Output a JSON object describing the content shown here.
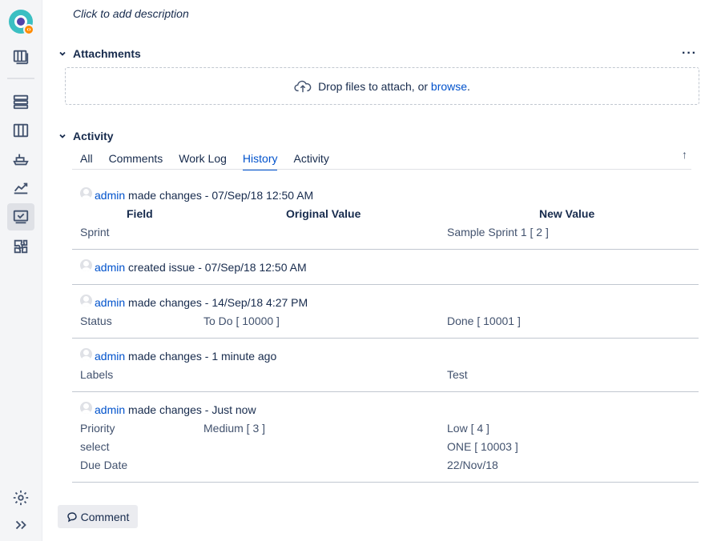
{
  "description": {
    "placeholder": "Click to add description"
  },
  "attachments": {
    "title": "Attachments",
    "more": "···",
    "drop_text": "Drop files to attach, or ",
    "browse": "browse",
    "period": "."
  },
  "activity": {
    "title": "Activity",
    "tabs": [
      "All",
      "Comments",
      "Work Log",
      "History",
      "Activity"
    ],
    "active_tab": "History",
    "sort_icon": "↑"
  },
  "history_headers": {
    "field": "Field",
    "original": "Original Value",
    "new": "New Value"
  },
  "history": [
    {
      "user": "admin",
      "action": " made changes - 07/Sep/18 12:50 AM",
      "rows": [
        {
          "field": "Sprint",
          "original": "",
          "new": "Sample Sprint 1 [ 2 ]"
        }
      ]
    },
    {
      "user": "admin",
      "action": " created issue - 07/Sep/18 12:50 AM",
      "rows": []
    },
    {
      "user": "admin",
      "action": " made changes - 14/Sep/18 4:27 PM",
      "rows": [
        {
          "field": "Status",
          "original": "To Do [ 10000 ]",
          "new": "Done [ 10001 ]"
        }
      ]
    },
    {
      "user": "admin",
      "action": " made changes - 1 minute ago",
      "rows": [
        {
          "field": "Labels",
          "original": "",
          "new": "Test"
        }
      ]
    },
    {
      "user": "admin",
      "action": " made changes - Just now",
      "rows": [
        {
          "field": "Priority",
          "original": "Medium [ 3 ]",
          "new": "Low [ 4 ]"
        },
        {
          "field": "select",
          "original": "",
          "new": "ONE [ 10003 ]"
        },
        {
          "field": "Due Date",
          "original": "",
          "new": "22/Nov/18"
        }
      ]
    }
  ],
  "comment_button": "Comment",
  "colors": {
    "link": "#0052cc",
    "sidebar": "#f4f5f7",
    "text": "#172b4d"
  },
  "sidebar_icons": [
    "app-logo",
    "board-icon",
    "backlog-icon",
    "columns-icon",
    "releases-icon",
    "reports-icon",
    "issues-icon",
    "addons-icon",
    "settings-icon",
    "expand-icon"
  ]
}
